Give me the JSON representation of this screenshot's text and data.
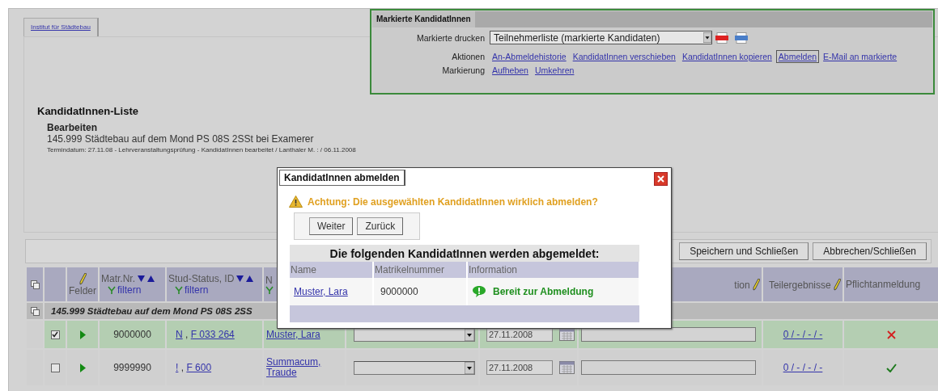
{
  "tab": {
    "label": "Institut für Städtebau",
    "selected": true
  },
  "marked_panel": {
    "title": "Markierte KandidatInnen",
    "print_label": "Markierte drucken",
    "print_select": "Teilnehmerliste (markierte Kandidaten)",
    "actions_label": "Aktionen",
    "actions": [
      {
        "label": "An-Abmeldehistorie",
        "selected": false
      },
      {
        "label": "KandidatInnen verschieben",
        "selected": false
      },
      {
        "label": "KandidatInnen kopieren",
        "selected": false
      },
      {
        "label": "Abmelden",
        "selected": true
      },
      {
        "label": "E-Mail an markierte",
        "selected": false
      }
    ],
    "marking_label": "Markierung",
    "marking": [
      "Aufheben",
      "Umkehren"
    ]
  },
  "heading": "KandidatInnen-Liste",
  "subheading": "Bearbeiten",
  "course": "145.999 Städtebau auf dem Mond PS 08S 2SSt bei Examerer",
  "term_info": "Termindatum: 27.11.08 - Lehrveranstaltungsprüfung - KandidatInnen bearbeitet / Lanthaler M. : / 06.11.2008",
  "toolbar": {
    "buttons": [
      "Speichern und Schließen",
      "Abbrechen/Schließen"
    ]
  },
  "table": {
    "columns": [
      {
        "kind": "copy"
      },
      {
        "kind": "blank"
      },
      {
        "kind": "fields",
        "label": "Felder"
      },
      {
        "kind": "sortable",
        "label": "Matr.Nr.",
        "filter": "filtern"
      },
      {
        "kind": "sortable",
        "label": "Stud-Status, ID",
        "filter": "filtern"
      },
      {
        "kind": "filter",
        "label": "N"
      },
      {
        "kind": "blank"
      },
      {
        "kind": "blank"
      },
      {
        "kind": "editable",
        "label": "tion"
      },
      {
        "kind": "editable",
        "label": "Teilergebnisse"
      },
      {
        "kind": "plain",
        "label": "Pflichtanmeldung"
      }
    ],
    "id_separator": ",",
    "group": "145.999 Städtebau auf dem Mond PS 08S 2SS",
    "rows": [
      {
        "checked": true,
        "matr": "9000000",
        "status": "N",
        "id": "F 033 264",
        "name": "Muster, Lara",
        "date": "27.11.2008",
        "result": "0 / - / - / -",
        "mandatory": false
      },
      {
        "checked": false,
        "matr": "9999990",
        "status": "!",
        "id": "F 600",
        "name": "Summacum, Traude",
        "date": "27.11.2008",
        "result": "0 / - / - / -",
        "mandatory": true
      }
    ]
  },
  "dialog": {
    "title": "KandidatInnen abmelden",
    "warning": "Achtung: Die ausgewählten KandidatInnen wirklich abmelden?",
    "buttons": [
      "Weiter",
      "Zurück"
    ],
    "list_title": "Die folgenden KandidatInnen werden abgemeldet:",
    "columns": [
      "Name",
      "Matrikelnummer",
      "Information"
    ],
    "rows": [
      {
        "name": "Muster, Lara",
        "matr": "9000000",
        "info": "Bereit zur Abmeldung"
      }
    ]
  }
}
